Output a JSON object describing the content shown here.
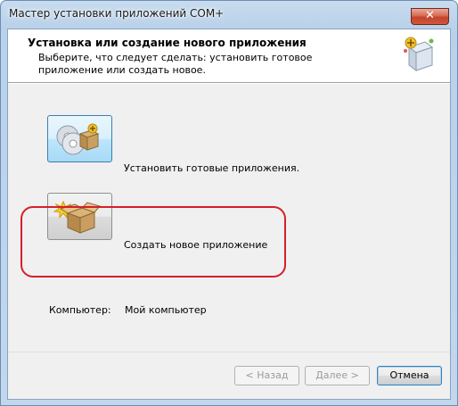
{
  "window": {
    "title": "Мастер установки приложений COM+",
    "close_label": "✕"
  },
  "header": {
    "title": "Установка или создание нового приложения",
    "subtitle": "Выберите, что следует сделать: установить готовое приложение или создать новое."
  },
  "options": [
    {
      "label": "Установить готовые приложения.",
      "icon": "install-cd-package-icon"
    },
    {
      "label": "Создать новое приложение",
      "icon": "new-package-icon"
    }
  ],
  "computer": {
    "label": "Компьютер:",
    "value": "Мой компьютер"
  },
  "footer": {
    "back_label": "< Назад",
    "next_label": "Далее >",
    "cancel_label": "Отмена"
  },
  "colors": {
    "highlight": "#d4202a",
    "titlebar": "#b9d1ea",
    "close_button": "#c4432b"
  }
}
